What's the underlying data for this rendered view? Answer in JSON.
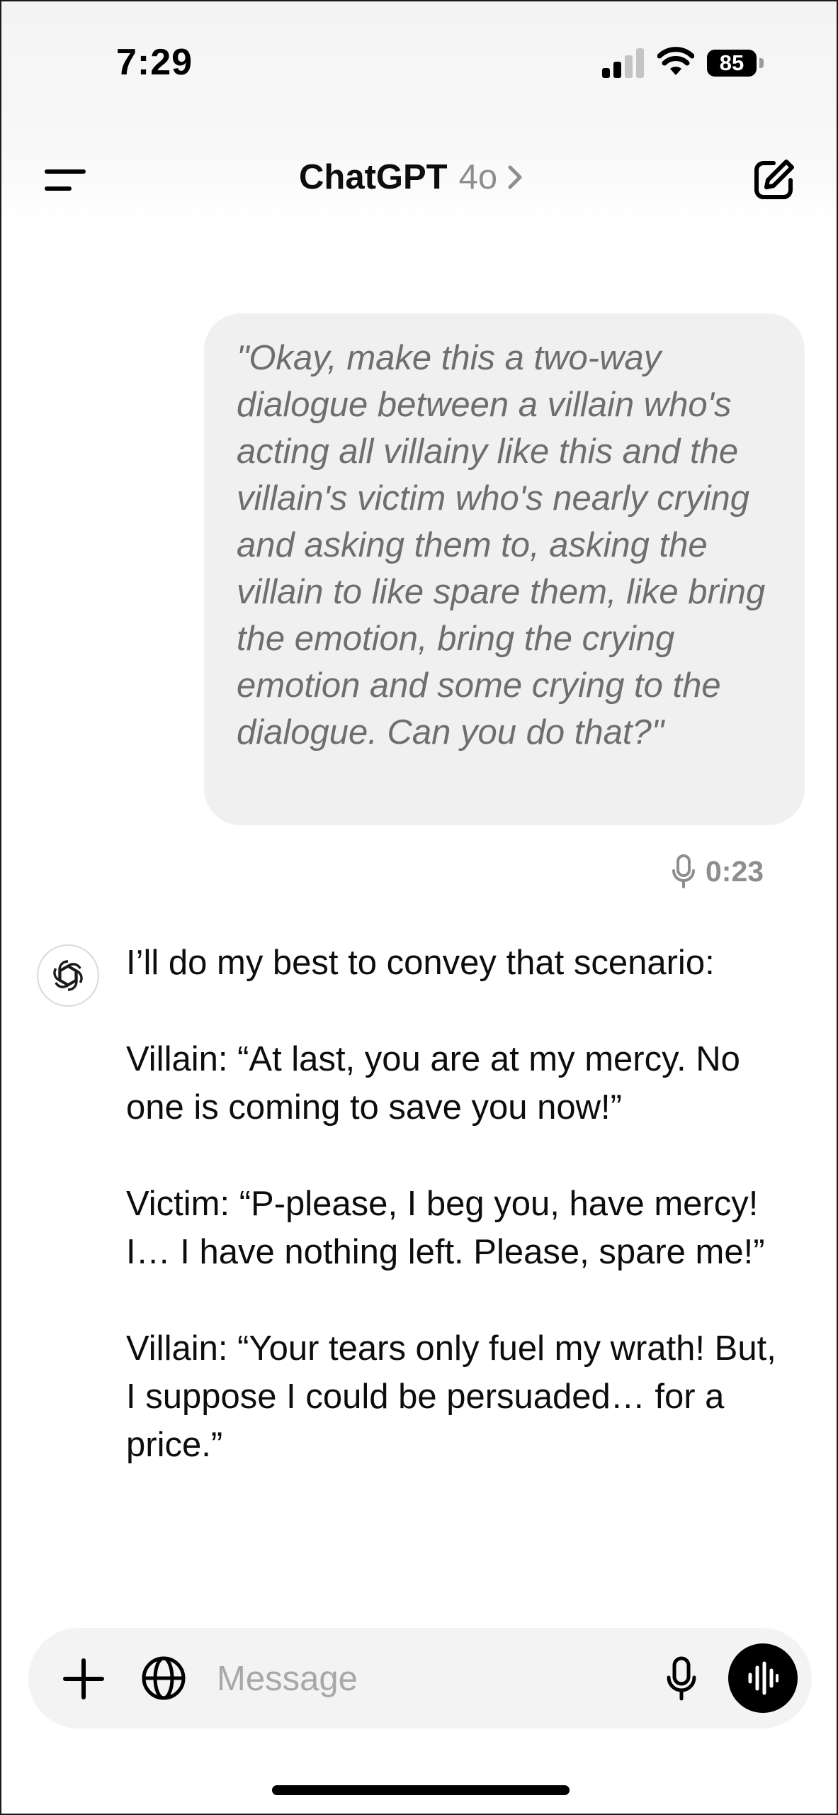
{
  "status_bar": {
    "time": "7:29",
    "battery_level": "85"
  },
  "nav": {
    "title": "ChatGPT",
    "model": "4o"
  },
  "user_message": {
    "text": "\"Okay, make this a two-way dialogue between a villain who's acting all villainy like this and the villain's victim who's nearly crying and asking them to, asking the villain to like spare them, like bring the emotion, bring the crying emotion and some crying to the dialogue. Can you do that?\"",
    "voice_duration": "0:23"
  },
  "assistant_message": {
    "paragraphs": [
      "I’ll do my best to convey that scenario:",
      "Villain: “At last, you are at my mercy. No one is coming to save you now!”",
      "Victim: “P-please, I beg you, have mercy! I… I have nothing left. Please, spare me!”",
      "Villain: “Your tears only fuel my wrath! But, I suppose I could be persuaded… for a price.”"
    ]
  },
  "composer": {
    "placeholder": "Message"
  },
  "icons": {
    "menu": "menu-icon",
    "new_chat": "new-chat-icon",
    "chevron": "chevron-right-icon",
    "mic_small": "microphone-icon",
    "assistant_logo": "openai-logo-icon",
    "plus": "plus-icon",
    "globe": "globe-icon",
    "mic": "microphone-icon",
    "voice_mode": "voice-waveform-icon"
  },
  "colors": {
    "bubble_bg": "#f0f0f0",
    "muted_text": "#8e8e8e",
    "composer_bg": "#f3f3f3",
    "accent_black": "#000000"
  }
}
